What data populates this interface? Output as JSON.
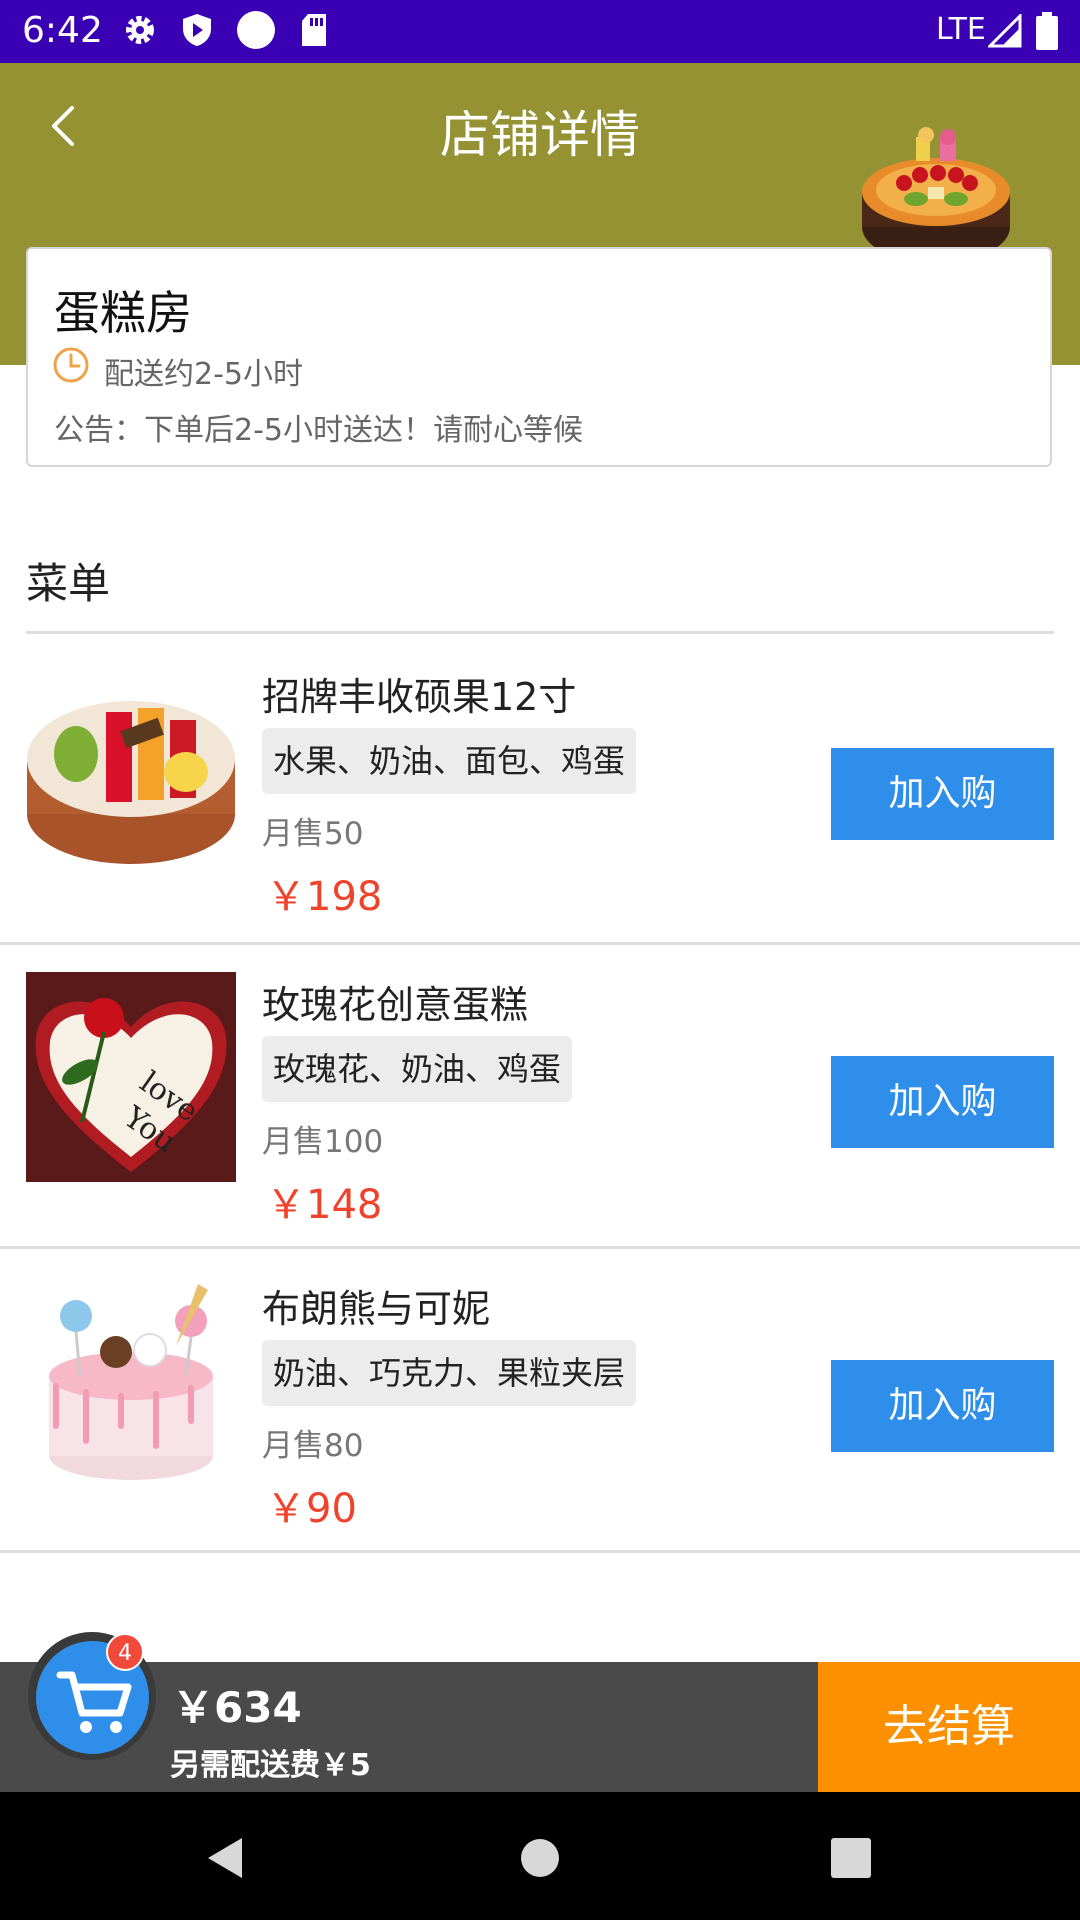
{
  "status_bar": {
    "time": "6:42",
    "network": "LTE",
    "icons": [
      "gear-icon",
      "shield-play-icon",
      "circle-icon",
      "sd-card-icon",
      "signal-icon",
      "battery-icon"
    ]
  },
  "header": {
    "title": "店铺详情",
    "back_icon": "chevron-left-icon"
  },
  "shop": {
    "name": "蛋糕房",
    "delivery_time": "配送约2-5小时",
    "notice": "公告：下单后2-5小时送达！请耐心等候"
  },
  "menu": {
    "title": "菜单",
    "add_label": "加入购",
    "items": [
      {
        "name": "招牌丰收硕果12寸",
        "tags": "水果、奶油、面包、鸡蛋",
        "sales": "月售50",
        "price": "￥198"
      },
      {
        "name": "玫瑰花创意蛋糕",
        "tags": "玫瑰花、奶油、鸡蛋",
        "sales": "月售100",
        "price": "￥148"
      },
      {
        "name": "布朗熊与可妮",
        "tags": "奶油、巧克力、果粒夹层",
        "sales": "月售80",
        "price": "￥90"
      }
    ]
  },
  "cart": {
    "count": "4",
    "total": "￥634",
    "delivery_fee": "另需配送费￥5",
    "checkout_label": "去结算"
  },
  "colors": {
    "status_bar": "#3a00b4",
    "header": "#959234",
    "button_blue": "#2f8eea",
    "price_red": "#f0432b",
    "checkout_orange": "#fc9000"
  }
}
